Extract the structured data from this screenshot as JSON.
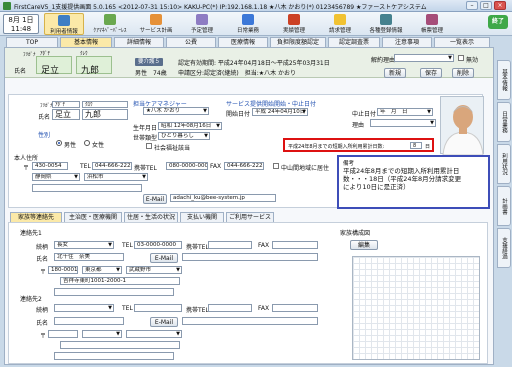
{
  "window": {
    "title": "FirstCareV5_1支援提供画面 5.0.165 <2012-07-31 15:10> KAKU-PC(*) IP:192.168.1.18 ★八木 かおり(*) 0123456789 ★ファーストケアシステム"
  },
  "toolbar": {
    "date_line1": "8月 1日",
    "date_line2": "11:48",
    "buttons": [
      {
        "label": "利用者情報",
        "color": "#3d7ec4"
      },
      {
        "label": "ｹｱﾏﾈﾍﾟｰﾊﾟｰﾚｽ",
        "color": "#6aa84f"
      },
      {
        "label": "サービス計画",
        "color": "#e69138"
      },
      {
        "label": "予定管理",
        "color": "#8e7cc3"
      },
      {
        "label": "日常業務",
        "color": "#3c78d8"
      },
      {
        "label": "実績管理",
        "color": "#cc4125"
      },
      {
        "label": "請求管理",
        "color": "#f1c232"
      },
      {
        "label": "各種登録情報",
        "color": "#45818e"
      },
      {
        "label": "帳票管理",
        "color": "#a64d79"
      }
    ],
    "end_label": "終了"
  },
  "tabs": [
    "TOP",
    "基本情報",
    "詳細情報",
    "公費",
    "医療情報",
    "負担限度額認定",
    "認定調査票",
    "注意事項",
    "一覧表示"
  ],
  "header": {
    "kana_label": "ﾌﾘｶﾞﾅ",
    "kana_sei": "ｱﾀﾞﾁ",
    "kana_mei": "ｸﾚｳ",
    "name_label": "氏名",
    "sei": "足立",
    "mei": "九郎",
    "status_badge": "要介護５",
    "gender_age": "男性　74歳",
    "recognition_period": "認定有効期間: 平成24年04月18日～平成25年03月31日",
    "application": "申請区分:認定済(継続)　担当:★八木 かおり",
    "cancel_reason_label": "解約理由",
    "invalid_label": "無効",
    "btn_new": "新規",
    "btn_save": "保存",
    "btn_delete": "削除"
  },
  "form": {
    "kana_label": "ﾌﾘｶﾞﾅ",
    "kana_sei": "ｱﾀﾞﾁ",
    "kana_mei": "ｸﾛｳ",
    "name_label": "氏名",
    "sei": "足立",
    "mei": "九郎",
    "care_manager_label": "担当ケアマネジャー",
    "care_manager_value": "★八木 かおり",
    "service_start_label": "サービス提供開始開始・中止日付",
    "start_date_label": "開始日付",
    "start_date_value": "平成 24年04月10日",
    "stop_date_label": "中止日付",
    "stop_date_value": "年　月　日",
    "reason_label": "理由",
    "gender_label": "性別",
    "male": "男性",
    "female": "女性",
    "birth_label": "生年月日",
    "birth_value": "昭和 12年08月16日",
    "household_label": "世帯類型",
    "household_value": "ひとり暮らし",
    "welfare_label": "社会福祉該当",
    "address_label": "本人住所",
    "zip_symbol": "〒",
    "zip": "430-0054",
    "tel_label": "TEL",
    "tel": "044-666-2222",
    "mobile_label": "携帯TEL",
    "mobile": "080-0000-0000",
    "fax_label": "FAX",
    "fax": "044-666-2222",
    "prefecture": "静岡県",
    "city": "浜松市",
    "return_label": "中山間地域に居住",
    "email_button": "E-Mail",
    "email": "adachi_ku@bee-system.jp",
    "red_notice": "平成24年8月までの短期入所利用累計日数:",
    "red_days": "8",
    "red_unit": "日",
    "memo_label": "備考",
    "memo_text": "平成24年8月までの短期入所利用累計日数・・・18日（平成24年8月分請求変更により10日に是正済）"
  },
  "subtabs": [
    "家族等連絡先",
    "主治医・医療機関",
    "住居・生活の状況",
    "支払い機関",
    "ご利用サービス"
  ],
  "contact1": {
    "heading": "連絡先1",
    "relation_label": "続柄",
    "relation": "長女",
    "tel_label": "TEL",
    "tel": "03-0000-0000",
    "mobile_label": "携帯TEL",
    "fax_label": "FAX",
    "name_label": "氏名",
    "name": "北千住　奈美",
    "email_button": "E-Mail",
    "zip_symbol": "〒",
    "zip": "180-0001",
    "prefecture": "東京都",
    "city": "武蔵野市",
    "address": "吉祥寺東町1001-2000-1"
  },
  "contact2": {
    "heading": "連絡先2",
    "relation_label": "続柄",
    "tel_label": "TEL",
    "mobile_label": "携帯TEL",
    "fax_label": "FAX",
    "name_label": "氏名",
    "email_button": "E-Mail",
    "zip_symbol": "〒"
  },
  "family_diagram": {
    "label": "家族構成図",
    "edit_button": "編集"
  },
  "side_tabs": [
    "基本情報",
    "日常業務",
    "利用状況",
    "計画書",
    "支援経過"
  ]
}
